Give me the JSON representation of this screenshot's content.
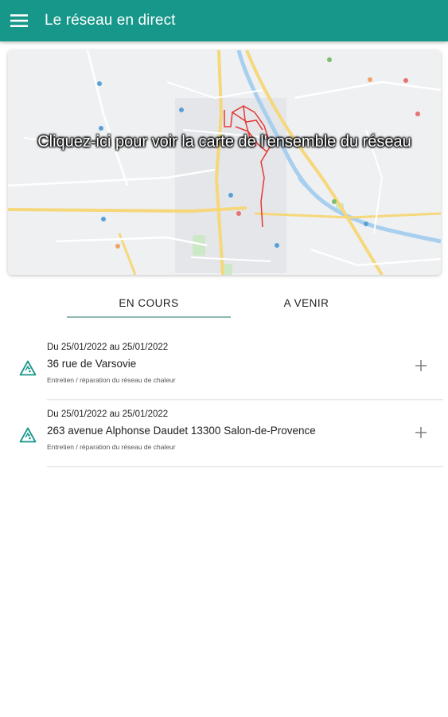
{
  "appbar": {
    "title": "Le réseau en direct",
    "menu_icon": "hamburger-menu-icon"
  },
  "map": {
    "cta": "Cliquez-ici pour voir la carte de l'ensemble du réseau"
  },
  "tabs": [
    {
      "label": "EN COURS",
      "selected": true
    },
    {
      "label": "A VENIR",
      "selected": false
    }
  ],
  "works": [
    {
      "date": "Du 25/01/2022 au 25/01/2022",
      "address": "36 rue de Varsovie",
      "type": "Entretien / réparation du réseau de chaleur",
      "icon": "warning-icon",
      "action_icon": "plus-icon"
    },
    {
      "date": "Du 25/01/2022 au 25/01/2022",
      "address": "263 avenue Alphonse Daudet 13300 Salon-de-Provence",
      "type": "Entretien / réparation du réseau de chaleur",
      "icon": "warning-icon",
      "action_icon": "plus-icon"
    }
  ],
  "colors": {
    "primary": "#16978a",
    "tab_indicator": "#8fb8b3",
    "warning_icon": "#16978a",
    "network_line": "#e53935"
  }
}
